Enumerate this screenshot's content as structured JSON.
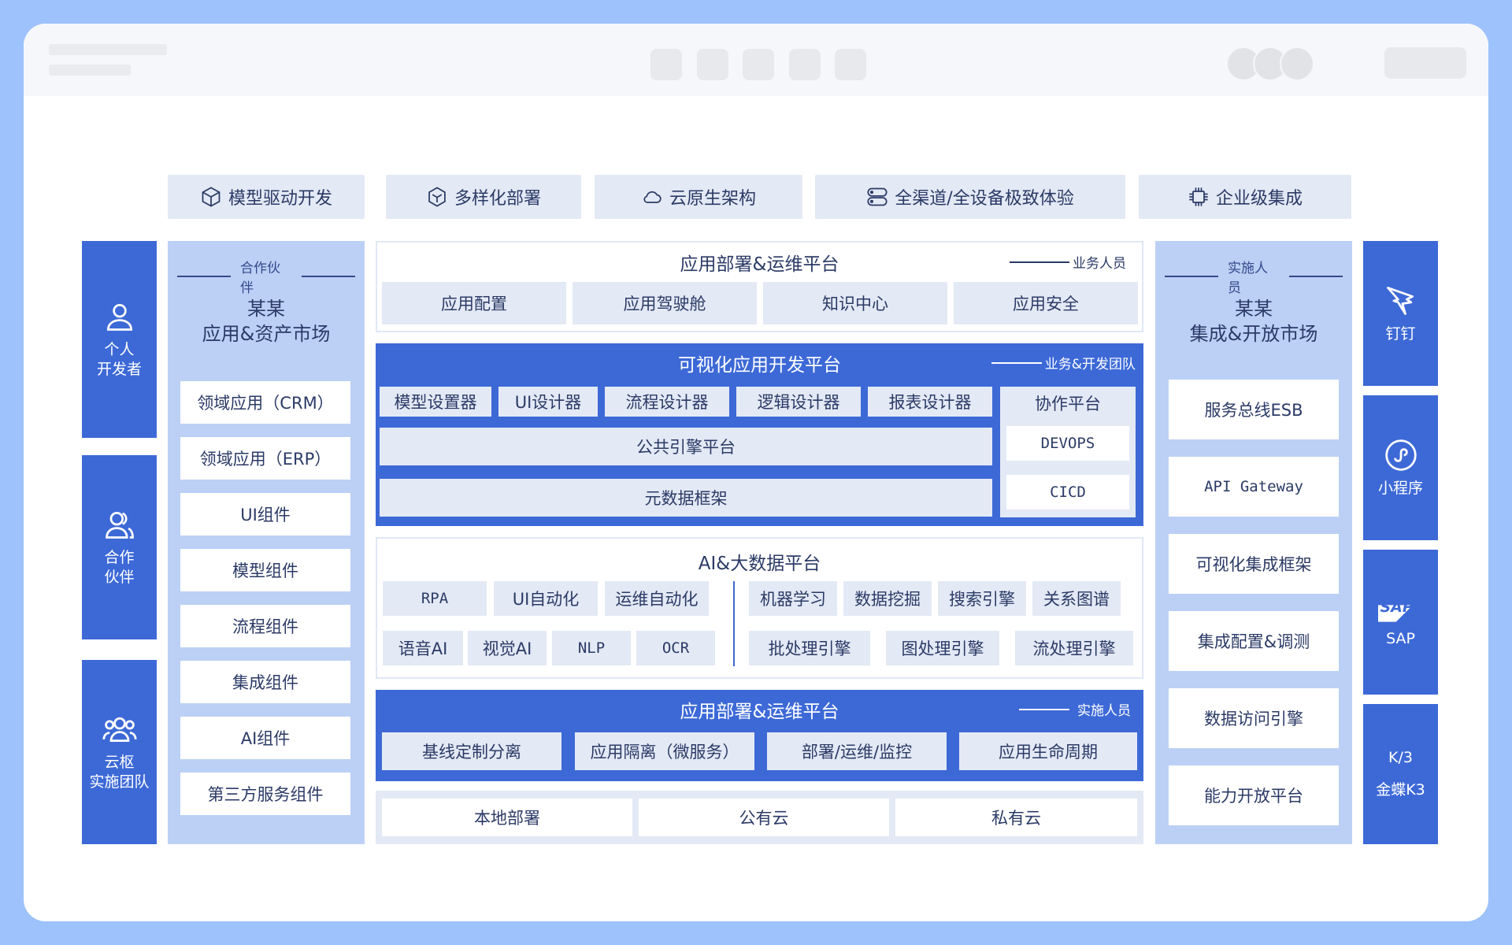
{
  "features": [
    {
      "icon": "cube-icon",
      "label": "模型驱动开发"
    },
    {
      "icon": "hexagon-icon",
      "label": "多样化部署"
    },
    {
      "icon": "cloud-icon",
      "label": "云原生架构"
    },
    {
      "icon": "server-icon",
      "label": "全渠道/全设备极致体验"
    },
    {
      "icon": "chip-icon",
      "label": "企业级集成"
    }
  ],
  "left_roles": [
    {
      "icon": "user-icon",
      "label": "个人\n开发者"
    },
    {
      "icon": "partner-icon",
      "label": "合作\n伙伴"
    },
    {
      "icon": "team-icon",
      "label": "云枢\n实施团队"
    }
  ],
  "left_market": {
    "tag": "合作伙伴",
    "title": "某某\n应用&资产市场",
    "items": [
      "领域应用（CRM）",
      "领域应用（ERP）",
      "UI组件",
      "模型组件",
      "流程组件",
      "集成组件",
      "AI组件",
      "第三方服务组件"
    ]
  },
  "ops_top": {
    "title": "应用部署&运维平台",
    "tag": "业务人员",
    "items": [
      "应用配置",
      "应用驾驶舱",
      "知识中心",
      "应用安全"
    ]
  },
  "visual_dev": {
    "title": "可视化应用开发平台",
    "tag": "业务&开发团队",
    "designers": [
      "模型设置器",
      "UI设计器",
      "流程设计器",
      "逻辑设计器",
      "报表设计器"
    ],
    "engine": "公共引擎平台",
    "metadata": "元数据框架",
    "collab": {
      "title": "协作平台",
      "items": [
        "DEVOPS",
        "CICD"
      ]
    }
  },
  "ai_bigdata": {
    "title": "AI&大数据平台",
    "left_row1": [
      "RPA",
      "UI自动化",
      "运维自动化"
    ],
    "left_row2": [
      "语音AI",
      "视觉AI",
      "NLP",
      "OCR"
    ],
    "right_row1": [
      "机器学习",
      "数据挖掘",
      "搜索引擎",
      "关系图谱"
    ],
    "right_row2": [
      "批处理引擎",
      "图处理引擎",
      "流处理引擎"
    ]
  },
  "ops_bottom": {
    "title": "应用部署&运维平台",
    "tag": "实施人员",
    "items": [
      "基线定制分离",
      "应用隔离（微服务）",
      "部署/运维/监控",
      "应用生命周期"
    ]
  },
  "deploy": [
    "本地部署",
    "公有云",
    "私有云"
  ],
  "right_market": {
    "tag": "实施人员",
    "title": "某某\n集成&开放市场",
    "items": [
      "服务总线ESB",
      "API Gateway",
      "可视化集成框架",
      "集成配置&调测",
      "数据访问引擎",
      "能力开放平台"
    ]
  },
  "right_apps": [
    {
      "icon": "dingtalk-icon",
      "label": "钉钉"
    },
    {
      "icon": "miniprogram-icon",
      "label": "小程序"
    },
    {
      "icon": "sap-logo-icon",
      "label": "SAP",
      "logo_text": "SAP"
    },
    {
      "icon": "kingdee-icon",
      "label": "金蝶K3",
      "top_text": "K/3"
    }
  ],
  "colors": {
    "primary": "#3d69d7",
    "light": "#bcd0f6",
    "cell": "#e3e9f5",
    "outer": "#9dc2fc"
  }
}
